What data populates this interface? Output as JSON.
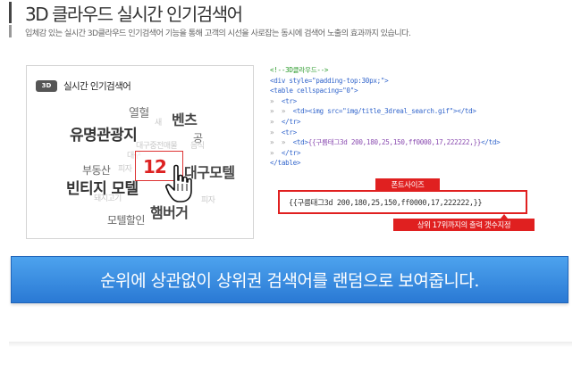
{
  "header": {
    "title": "3D 클라우드 실시간 인기검색어",
    "description": "입체감 있는 실시간 3D클라우드 인기검색어 기능을 통해 고객의 시선을 사로잡는 동시에 검색어 노출의 효과까지 있습니다."
  },
  "cloud": {
    "badge": "3D",
    "title": "실시간 인기검색어",
    "highlight_number": "12",
    "words": [
      {
        "text": "열혈",
        "style": "faint-large"
      },
      {
        "text": "새",
        "style": "faint"
      },
      {
        "text": "벤츠",
        "style": "bold-large"
      },
      {
        "text": "유명관광지",
        "style": "bold-xlarge"
      },
      {
        "text": "공",
        "style": "medium"
      },
      {
        "text": "대구중전매물",
        "style": "faint"
      },
      {
        "text": "음식",
        "style": "faint"
      },
      {
        "text": "대구",
        "style": "faint"
      },
      {
        "text": "부동산",
        "style": "medium"
      },
      {
        "text": "피자",
        "style": "faint"
      },
      {
        "text": "대구모텔",
        "style": "bold-large"
      },
      {
        "text": "빈티지 모텔",
        "style": "bold-xlarge"
      },
      {
        "text": "피자",
        "style": "faint"
      },
      {
        "text": "돼지고기",
        "style": "faint"
      },
      {
        "text": "햄버거",
        "style": "bold-large"
      },
      {
        "text": "모텔할인",
        "style": "medium"
      }
    ]
  },
  "code": {
    "lines": [
      {
        "segments": [
          {
            "t": "<!--3D클라우드-->",
            "c": "green"
          }
        ]
      },
      {
        "segments": [
          {
            "t": "<div style=\"padding-top:30px;\">",
            "c": "blue"
          }
        ]
      },
      {
        "segments": [
          {
            "t": "<table cellspacing=\"0\">",
            "c": "blue"
          }
        ]
      },
      {
        "segments": [
          {
            "t": "»  ",
            "c": "gray"
          },
          {
            "t": "<tr>",
            "c": "blue"
          }
        ]
      },
      {
        "segments": [
          {
            "t": "»  »  ",
            "c": "gray"
          },
          {
            "t": "<td><img src=\"img/title_3dreal_search.gif\"></td>",
            "c": "blue"
          }
        ]
      },
      {
        "segments": [
          {
            "t": "»  ",
            "c": "gray"
          },
          {
            "t": "</tr>",
            "c": "blue"
          }
        ]
      },
      {
        "segments": [
          {
            "t": "»  ",
            "c": "gray"
          },
          {
            "t": "<tr>",
            "c": "blue"
          }
        ]
      },
      {
        "segments": [
          {
            "t": "»  »  ",
            "c": "gray"
          },
          {
            "t": "<td>",
            "c": "blue"
          },
          {
            "t": "{{구름태그3d 200,180,25,150,ff0000,17,222222,}}",
            "c": "purple"
          },
          {
            "t": "</td>",
            "c": "blue"
          }
        ]
      },
      {
        "segments": [
          {
            "t": "»  ",
            "c": "gray"
          },
          {
            "t": "</tr>",
            "c": "blue"
          }
        ]
      },
      {
        "segments": [
          {
            "t": "</table>",
            "c": "blue"
          }
        ]
      }
    ]
  },
  "annotations": {
    "font_size_label": "폰트사이즈",
    "tag_code": "{{구름태그3d 200,180,25,150,ff0000,17,222222,}}",
    "count_label": "상위 17위까지의 출력 갯수지정"
  },
  "banner": {
    "text": "순위에 상관없이 상위권 검색어를 랜덤으로 보여줍니다."
  },
  "colors": {
    "accent_red": "#e02020",
    "banner_blue": "#2a79d4",
    "code_green": "#2a9a2a",
    "code_blue": "#3366cc",
    "code_purple": "#8a4bb0"
  }
}
